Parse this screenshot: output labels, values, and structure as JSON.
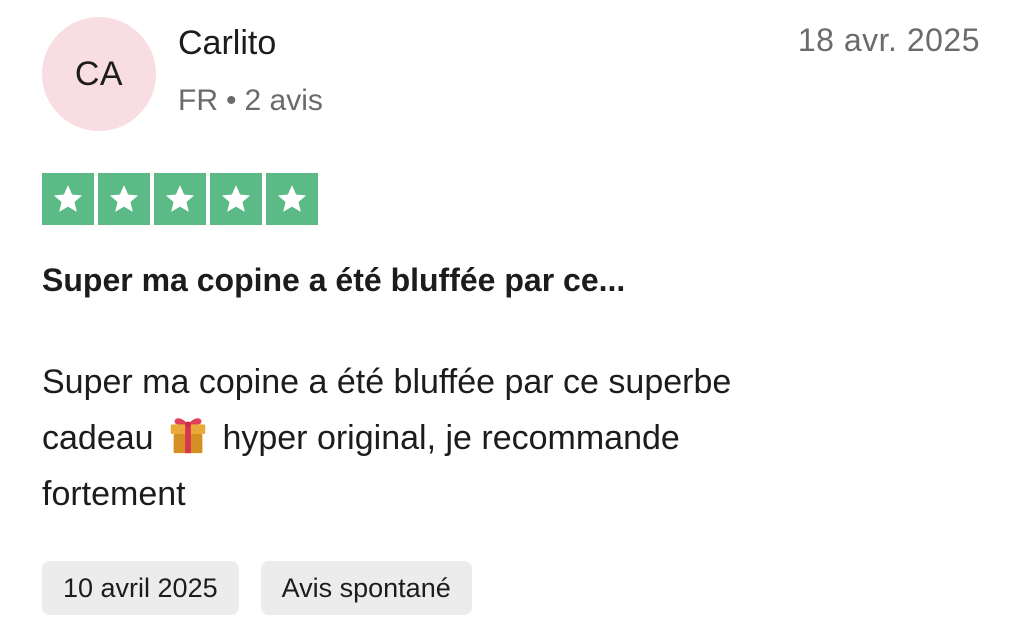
{
  "reviewer": {
    "initials": "CA",
    "name": "Carlito",
    "country": "FR",
    "separator": "•",
    "review_count": "2 avis"
  },
  "review": {
    "date": "18 avr. 2025",
    "rating": 5,
    "rating_max": 5,
    "title": "Super ma copine a été bluffée par ce...",
    "body_part1": "Super ma copine a été bluffée par ce superbe cadeau",
    "body_icon": "gift-icon",
    "body_part2": "hyper original, je recommande fortement"
  },
  "tags": {
    "experience_date": "10 avril 2025",
    "review_type": "Avis spontané"
  },
  "colors": {
    "star_background": "#5bba85",
    "avatar_background": "#f8dde3",
    "tag_background": "#ececec",
    "muted_text": "#6b6b6b"
  }
}
